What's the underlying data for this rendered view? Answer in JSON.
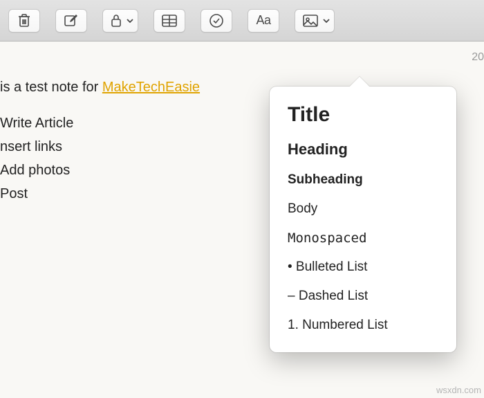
{
  "toolbar": {
    "delete": "Delete",
    "compose": "New Note",
    "lock": "Lock",
    "table": "Table",
    "checklist": "Checklist",
    "format_label": "Aa",
    "media": "Media"
  },
  "meta": {
    "year_fragment": "20"
  },
  "note": {
    "intro_prefix": "is a test note for ",
    "intro_link": "MakeTechEasie",
    "items": [
      "Write Article",
      "nsert links",
      "Add photos",
      "Post"
    ]
  },
  "format_menu": {
    "title": "Title",
    "heading": "Heading",
    "subheading": "Subheading",
    "body": "Body",
    "monospaced": "Monospaced",
    "bulleted": "• Bulleted List",
    "dashed": "– Dashed List",
    "numbered": "1. Numbered List"
  },
  "watermark": "wsxdn.com"
}
